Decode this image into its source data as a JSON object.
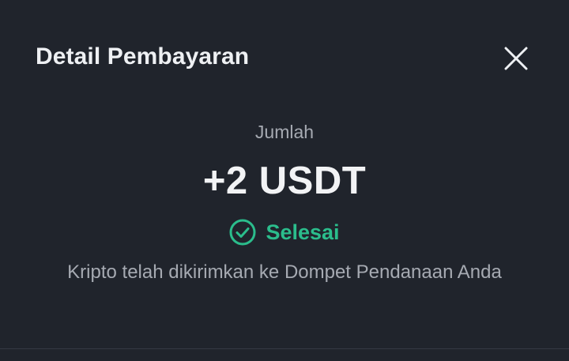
{
  "dialog": {
    "title": "Detail Pembayaran",
    "close_icon": "close-icon"
  },
  "payment": {
    "amount_label": "Jumlah",
    "amount_value": "+2 USDT",
    "status_icon": "check-circle-icon",
    "status_label": "Selesai",
    "note": "Kripto telah dikirimkan ke Dompet Pendanaan Anda"
  },
  "colors": {
    "background": "#20242c",
    "success": "#2bbd8c",
    "muted_text": "#a6aab2"
  }
}
